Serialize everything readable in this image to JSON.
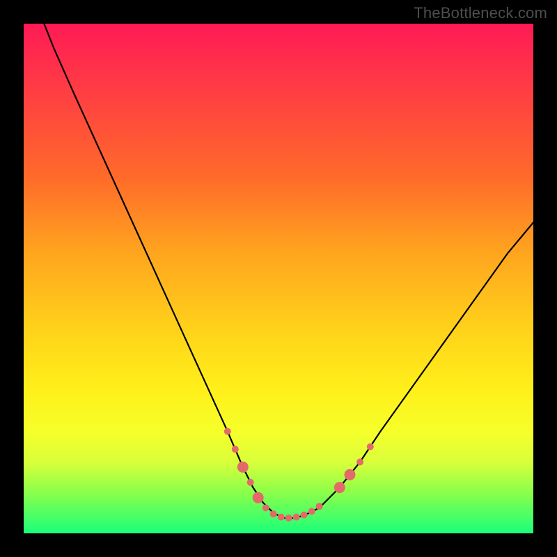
{
  "attribution": "TheBottleneck.com",
  "chart_data": {
    "type": "line",
    "title": "",
    "xlabel": "",
    "ylabel": "",
    "xlim": [
      0,
      100
    ],
    "ylim": [
      0,
      100
    ],
    "grid": false,
    "legend": false,
    "series": [
      {
        "name": "curve",
        "x": [
          4,
          6,
          10,
          15,
          20,
          25,
          30,
          35,
          40,
          43,
          45,
          47,
          49,
          51,
          53,
          55,
          58,
          62,
          66,
          70,
          75,
          80,
          85,
          90,
          95,
          100
        ],
        "y": [
          100,
          95,
          86,
          75,
          64,
          53,
          42,
          31,
          20,
          13,
          9,
          6,
          4,
          3,
          3,
          3.5,
          5,
          9,
          14,
          20,
          27,
          34,
          41,
          48,
          55,
          61
        ]
      }
    ],
    "markers": {
      "name": "highlight-dots",
      "color": "#e46a6a",
      "radius_small": 5,
      "radius_large": 8,
      "points": [
        {
          "x": 40.0,
          "y": 20.0,
          "r": "small"
        },
        {
          "x": 41.5,
          "y": 16.5,
          "r": "small"
        },
        {
          "x": 43.0,
          "y": 13.0,
          "r": "large"
        },
        {
          "x": 44.5,
          "y": 10.0,
          "r": "small"
        },
        {
          "x": 46.0,
          "y": 7.0,
          "r": "large"
        },
        {
          "x": 47.5,
          "y": 5.0,
          "r": "small"
        },
        {
          "x": 49.0,
          "y": 3.8,
          "r": "small"
        },
        {
          "x": 50.5,
          "y": 3.2,
          "r": "small"
        },
        {
          "x": 52.0,
          "y": 3.0,
          "r": "small"
        },
        {
          "x": 53.5,
          "y": 3.2,
          "r": "small"
        },
        {
          "x": 55.0,
          "y": 3.6,
          "r": "small"
        },
        {
          "x": 56.5,
          "y": 4.3,
          "r": "small"
        },
        {
          "x": 58.0,
          "y": 5.3,
          "r": "small"
        },
        {
          "x": 62.0,
          "y": 9.0,
          "r": "large"
        },
        {
          "x": 64.0,
          "y": 11.5,
          "r": "large"
        },
        {
          "x": 66.0,
          "y": 14.0,
          "r": "small"
        },
        {
          "x": 68.0,
          "y": 17.0,
          "r": "small"
        }
      ]
    },
    "gradient_stops": [
      {
        "pos": 0,
        "color": "#ff1a55"
      },
      {
        "pos": 12,
        "color": "#ff3a45"
      },
      {
        "pos": 30,
        "color": "#ff6a2a"
      },
      {
        "pos": 45,
        "color": "#ffa51e"
      },
      {
        "pos": 60,
        "color": "#ffd21a"
      },
      {
        "pos": 72,
        "color": "#fff01a"
      },
      {
        "pos": 80,
        "color": "#f6ff2a"
      },
      {
        "pos": 86,
        "color": "#d9ff3a"
      },
      {
        "pos": 92,
        "color": "#8bff4a"
      },
      {
        "pos": 100,
        "color": "#1aff7a"
      }
    ]
  }
}
